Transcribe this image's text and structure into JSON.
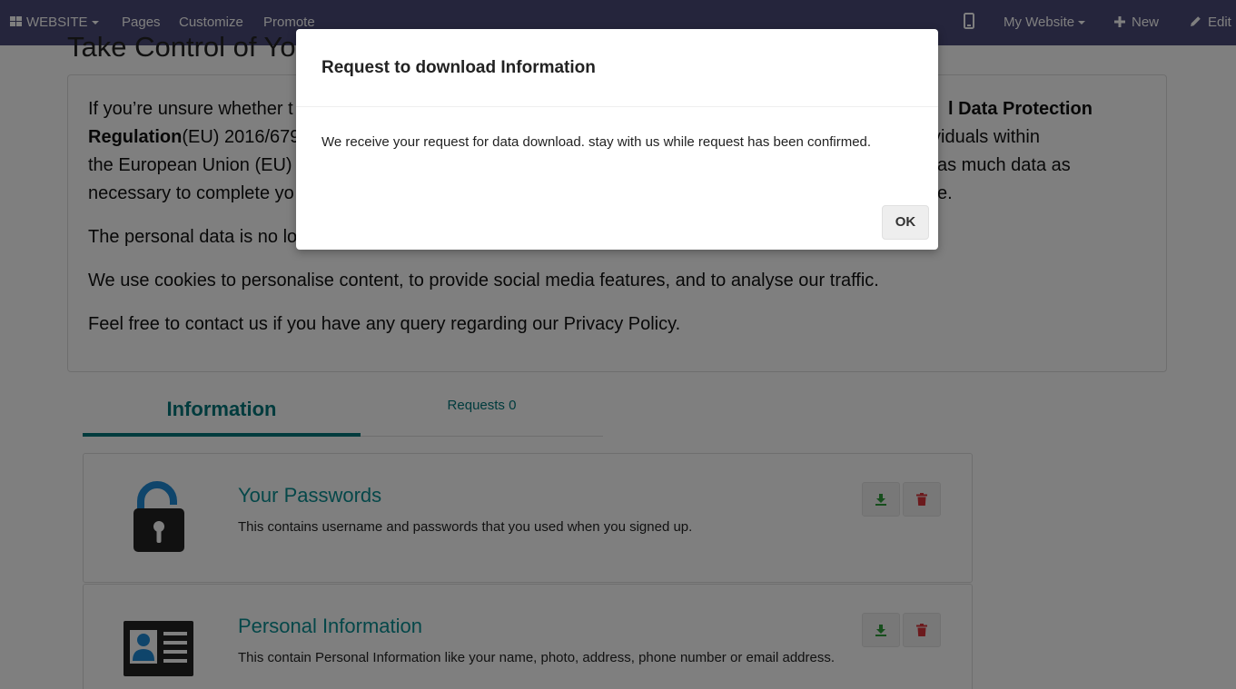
{
  "navbar": {
    "website_menu": "WEBSITE",
    "pages": "Pages",
    "customize": "Customize",
    "promote": "Promote",
    "my_website": "My Website",
    "new": "New",
    "edit": "Edit"
  },
  "page": {
    "title": "Take Control of You",
    "paragraph1": {
      "line1_start": "If you’re unsure whether t",
      "line1_bold": "l Data Protection",
      "line2_bold": "Regulation",
      "line2_text": "(EU) 2016/679",
      "line2_end": "viduals within",
      "line3_start": "the European Union (EU)",
      "line3_end": "as much data as",
      "line4_start": "necessary to complete yo",
      "line4_end": "e."
    },
    "paragraph2": "The personal data is no lo",
    "paragraph3": "We use cookies to personalise content, to provide social media features, and to analyse our traffic.",
    "paragraph4": "Feel free to contact us if you have any query regarding our Privacy Policy."
  },
  "tabs": {
    "information": "Information",
    "requests": "Requests 0"
  },
  "cards": [
    {
      "title": "Your Passwords",
      "description": "This contains username and passwords that you used when you signed up.",
      "icon": "unlocked-padlock-icon"
    },
    {
      "title": "Personal Information",
      "description": "This contain Personal Information like your name, photo, address, phone number or email address.",
      "icon": "id-card-icon"
    }
  ],
  "modal": {
    "title": "Request to download Information",
    "body": "We receive your request for data download. stay with us while request has been confirmed.",
    "ok": "OK"
  },
  "colors": {
    "navbar": "#4b4a78",
    "accent": "#00767a",
    "download_green": "#2e9c3a",
    "delete_red": "#d9343a",
    "padlock_blue": "#1e8ad6"
  }
}
